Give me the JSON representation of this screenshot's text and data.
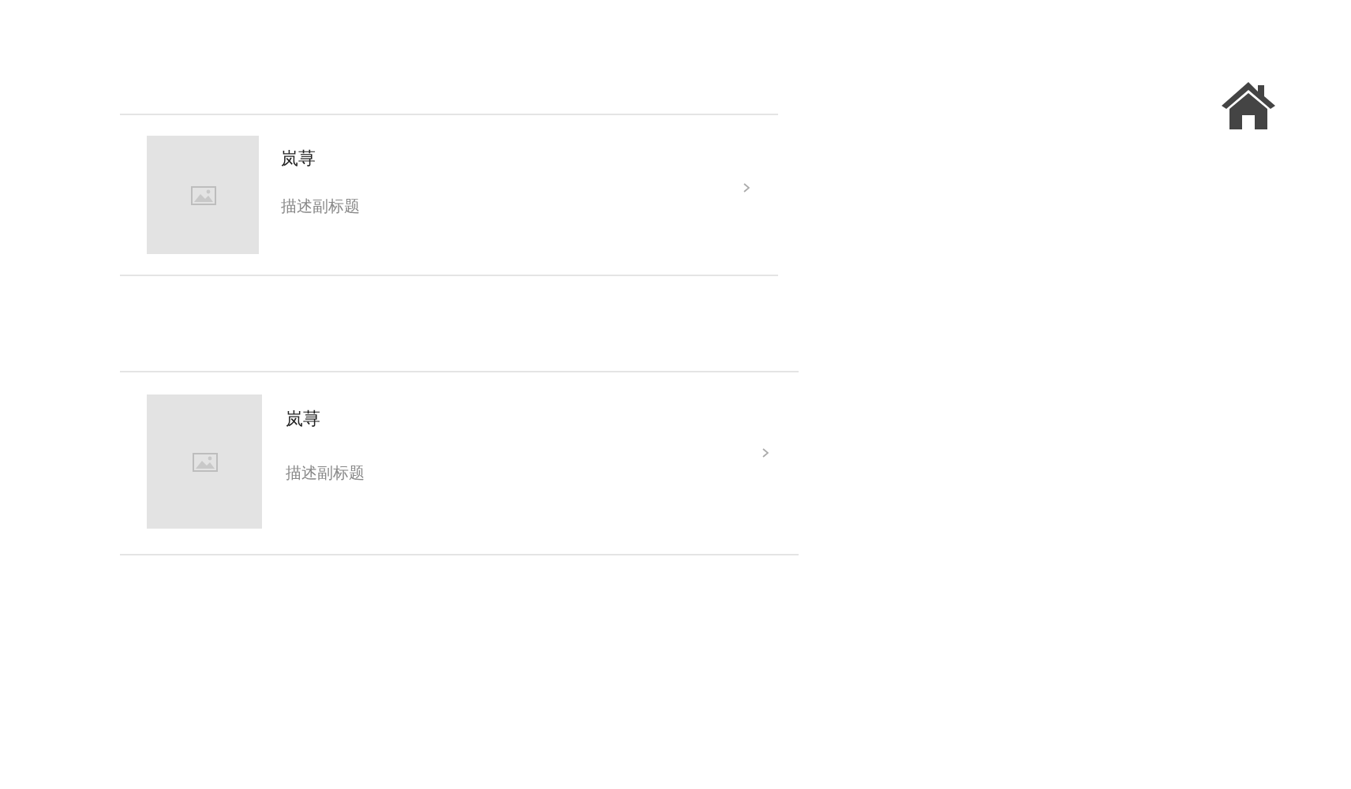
{
  "cards": [
    {
      "title": "岚荨",
      "subtitle": "描述副标题"
    },
    {
      "title": "岚荨",
      "subtitle": "描述副标题"
    }
  ]
}
